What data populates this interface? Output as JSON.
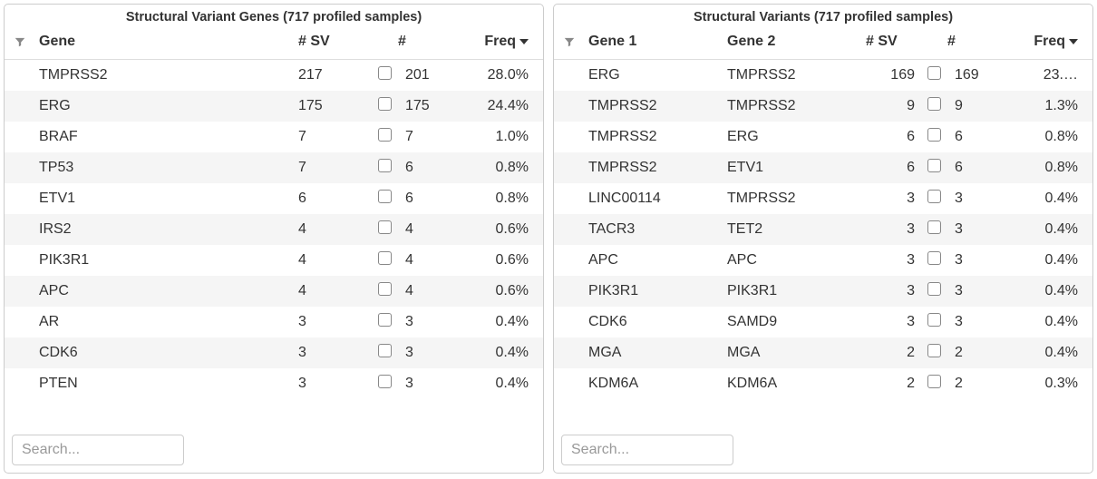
{
  "left": {
    "title": "Structural Variant Genes (717 profiled samples)",
    "headers": {
      "gene": "Gene",
      "sv": "# SV",
      "num": "#",
      "freq": "Freq"
    },
    "search_placeholder": "Search...",
    "rows": [
      {
        "gene": "TMPRSS2",
        "sv": "217",
        "num": "201",
        "freq": "28.0%"
      },
      {
        "gene": "ERG",
        "sv": "175",
        "num": "175",
        "freq": "24.4%"
      },
      {
        "gene": "BRAF",
        "sv": "7",
        "num": "7",
        "freq": "1.0%"
      },
      {
        "gene": "TP53",
        "sv": "7",
        "num": "6",
        "freq": "0.8%"
      },
      {
        "gene": "ETV1",
        "sv": "6",
        "num": "6",
        "freq": "0.8%"
      },
      {
        "gene": "IRS2",
        "sv": "4",
        "num": "4",
        "freq": "0.6%"
      },
      {
        "gene": "PIK3R1",
        "sv": "4",
        "num": "4",
        "freq": "0.6%"
      },
      {
        "gene": "APC",
        "sv": "4",
        "num": "4",
        "freq": "0.6%"
      },
      {
        "gene": "AR",
        "sv": "3",
        "num": "3",
        "freq": "0.4%"
      },
      {
        "gene": "CDK6",
        "sv": "3",
        "num": "3",
        "freq": "0.4%"
      },
      {
        "gene": "PTEN",
        "sv": "3",
        "num": "3",
        "freq": "0.4%"
      }
    ]
  },
  "right": {
    "title": "Structural Variants (717 profiled samples)",
    "headers": {
      "gene1": "Gene 1",
      "gene2": "Gene 2",
      "sv": "# SV",
      "num": "#",
      "freq": "Freq"
    },
    "search_placeholder": "Search...",
    "rows": [
      {
        "gene1": "ERG",
        "gene2": "TMPRSS2",
        "sv": "169",
        "num": "169",
        "freq": "23.…"
      },
      {
        "gene1": "TMPRSS2",
        "gene2": "TMPRSS2",
        "sv": "9",
        "num": "9",
        "freq": "1.3%"
      },
      {
        "gene1": "TMPRSS2",
        "gene2": "ERG",
        "sv": "6",
        "num": "6",
        "freq": "0.8%"
      },
      {
        "gene1": "TMPRSS2",
        "gene2": "ETV1",
        "sv": "6",
        "num": "6",
        "freq": "0.8%"
      },
      {
        "gene1": "LINC00114",
        "gene2": "TMPRSS2",
        "sv": "3",
        "num": "3",
        "freq": "0.4%"
      },
      {
        "gene1": "TACR3",
        "gene2": "TET2",
        "sv": "3",
        "num": "3",
        "freq": "0.4%"
      },
      {
        "gene1": "APC",
        "gene2": "APC",
        "sv": "3",
        "num": "3",
        "freq": "0.4%"
      },
      {
        "gene1": "PIK3R1",
        "gene2": "PIK3R1",
        "sv": "3",
        "num": "3",
        "freq": "0.4%"
      },
      {
        "gene1": "CDK6",
        "gene2": "SAMD9",
        "sv": "3",
        "num": "3",
        "freq": "0.4%"
      },
      {
        "gene1": "MGA",
        "gene2": "MGA",
        "sv": "2",
        "num": "2",
        "freq": "0.4%"
      },
      {
        "gene1": "KDM6A",
        "gene2": "KDM6A",
        "sv": "2",
        "num": "2",
        "freq": "0.3%"
      }
    ]
  }
}
